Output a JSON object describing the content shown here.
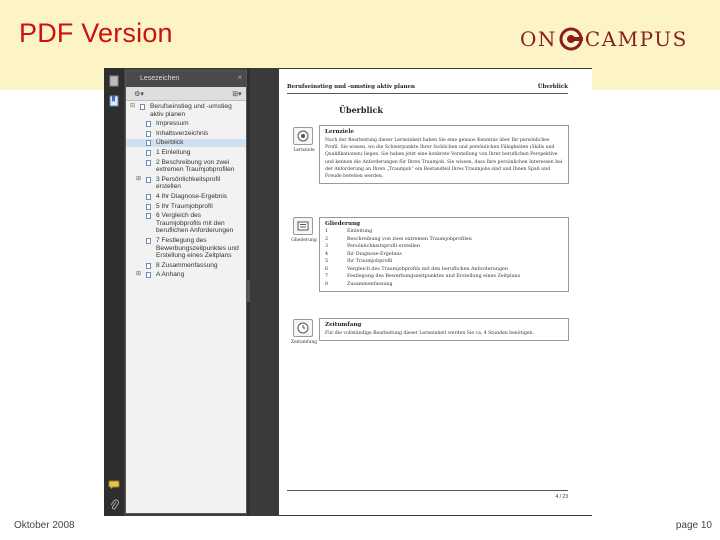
{
  "slide": {
    "title": "PDF Version",
    "logo": {
      "left": "ON",
      "right": "CAMPUS",
      "accent": "#8a1e1e"
    },
    "footer_left": "Oktober 2008",
    "footer_right": "page 10",
    "title_color": "#cc1111",
    "band_color": "#fcf4c4"
  },
  "app": {
    "panel_title": "Lesezeichen",
    "panel_close": "×",
    "rail_icons": [
      "pages-icon",
      "bookmark-icon",
      "comment-icon",
      "attachment-icon"
    ],
    "tools": {
      "options": "⚙▾",
      "expand": "⊞▾"
    },
    "bookmarks": [
      {
        "label": "Berufseinstieg und -umstieg aktiv planen",
        "root": true
      },
      {
        "label": "Impressum"
      },
      {
        "label": "Inhaltsverzeichnis"
      },
      {
        "label": "Überblick",
        "selected": true
      },
      {
        "label": "1 Einleitung"
      },
      {
        "label": "2 Beschreibung von zwei extremen Traumjobprofilen"
      },
      {
        "label": "3 Persönlichkeitsprofil erstellen",
        "toggle": true
      },
      {
        "label": "4 Ihr Diagnose-Ergebnis"
      },
      {
        "label": "5 Ihr Traumjobprofil"
      },
      {
        "label": "6 Vergleich des Traumjobprofils mit den beruflichen Anforderungen"
      },
      {
        "label": "7 Festlegung des Bewerbungszeitpunktes und Erstellung eines Zeitplans"
      },
      {
        "label": "8 Zusammenfassung"
      },
      {
        "label": "A Anhang",
        "toggle": true
      }
    ]
  },
  "pdf": {
    "header_left": "Berufseinstieg und -umstieg aktiv planen",
    "header_right": "Überblick",
    "heading": "Überblick",
    "lernziele": {
      "side_label": "Lernziele",
      "title": "Lernziele",
      "text": "Nach der Bearbeitung dieser Lerneinheit haben Sie eine genaue Kenntnis über Ihr persönliches Profil. Sie wissen, wo die Schwerpunkte Ihrer fachlichen und persönlichen Fähigkeiten (Skills und Qualifikationen) liegen. Sie haben jetzt eine konkrete Vorstellung von Ihrer beruflichen Perspektive und kennen die Anforderungen für Ihren Traumjob. Sie wissen, dass Ihre persönlichen Interessen bei der Anforderung an Ihren „Traumjob“ ein Bestandteil Ihres Traumjobs sind und Ihnen Spaß und Freude bereiten werden."
    },
    "gliederung": {
      "side_label": "Gliederung",
      "title": "Gliederung",
      "items": [
        {
          "num": "1",
          "text": "Einleitung"
        },
        {
          "num": "2",
          "text": "Beschreibung von zwei extremen Traumjobprofilen"
        },
        {
          "num": "3",
          "text": "Persönlichkeitsprofil erstellen"
        },
        {
          "num": "4",
          "text": "Ihr Diagnose-Ergebnis"
        },
        {
          "num": "5",
          "text": "Ihr Traumjobprofil"
        },
        {
          "num": "6",
          "text": "Vergleich des Traumjobprofils mit den beruflichen Anforderungen"
        },
        {
          "num": "7",
          "text": "Festlegung des Bewerbungszeitpunktes und Erstellung eines Zeitplans"
        },
        {
          "num": "8",
          "text": "Zusammenfassung"
        }
      ]
    },
    "zeitumfang": {
      "side_label": "Zeitumfang",
      "title": "Zeitumfang",
      "text": "Für die vollständige Bearbeitung dieser Lerneinheit werden Sie ca. 4 Stunden benötigen."
    },
    "page_number": "4 / 23"
  }
}
